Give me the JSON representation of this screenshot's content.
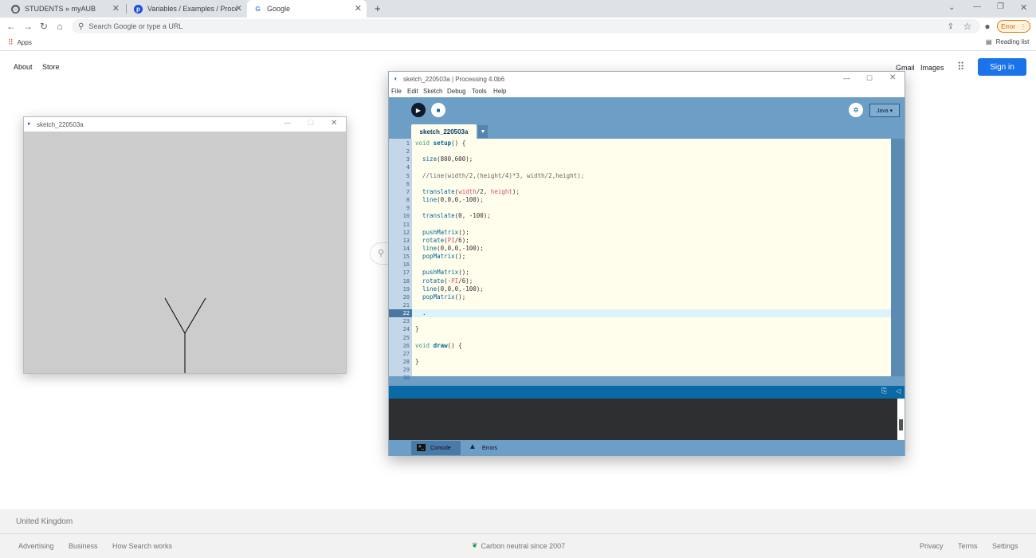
{
  "browser": {
    "tabs": [
      {
        "title": "STUDENTS » myAUB",
        "active": false
      },
      {
        "title": "Variables / Examples / Processing",
        "active": false
      },
      {
        "title": "Google",
        "active": true
      }
    ],
    "new_tab_label": "+",
    "omnibox_placeholder": "Search Google or type a URL",
    "error_label": "Error",
    "bookmarks": {
      "apps_label": "Apps",
      "reading_list_label": "Reading list"
    }
  },
  "google": {
    "left_links": [
      "About",
      "Store"
    ],
    "right_links": [
      "Gmail",
      "Images"
    ],
    "signin_label": "Sign in",
    "footer": {
      "country": "United Kingdom",
      "left_links": [
        "Advertising",
        "Business",
        "How Search works"
      ],
      "center_text": "Carbon neutral since 2007",
      "right_links": [
        "Privacy",
        "Terms",
        "Settings"
      ]
    }
  },
  "sketch_window": {
    "title": "sketch_220503a"
  },
  "ide": {
    "title": "sketch_220503a | Processing 4.0b6",
    "menu": [
      "File",
      "Edit",
      "Sketch",
      "Debug",
      "Tools",
      "Help"
    ],
    "tab_name": "sketch_220503a",
    "mode_label": "Java ▾",
    "current_line": 22,
    "code_lines": [
      "void setup() {",
      "",
      "  size(800,600);",
      "",
      "  //line(width/2,(height/4)*3, width/2,height);",
      "",
      "  translate(width/2, height);",
      "  line(0,0,0,-100);",
      "",
      "  translate(0, -100);",
      "",
      "  pushMatrix();",
      "  rotate(PI/6);",
      "  line(0,0,0,-100);",
      "  popMatrix();",
      "",
      "  pushMatrix();",
      "  rotate(-PI/6);",
      "  line(0,0,0,-100);",
      "  popMatrix();",
      "",
      "  .",
      "",
      "}",
      "",
      "void draw() {",
      "",
      "}",
      "",
      ""
    ],
    "console_tab_label": "Console",
    "errors_tab_label": "Errors"
  }
}
